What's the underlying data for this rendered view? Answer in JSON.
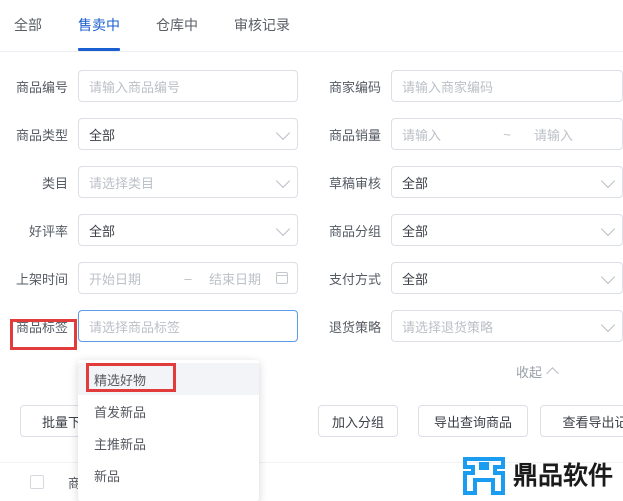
{
  "tabs": [
    {
      "label": "全部",
      "active": false
    },
    {
      "label": "售卖中",
      "active": true
    },
    {
      "label": "仓库中",
      "active": false
    },
    {
      "label": "审核记录",
      "active": false
    }
  ],
  "filters": {
    "rows": [
      {
        "left": {
          "label": "商品编号",
          "type": "input",
          "placeholder": "请输入商品编号",
          "value": ""
        },
        "right": {
          "label": "商家编码",
          "type": "input",
          "placeholder": "请输入商家编码",
          "value": ""
        }
      },
      {
        "left": {
          "label": "商品类型",
          "type": "select",
          "placeholder": "",
          "value": "全部"
        },
        "right": {
          "label": "商品销量",
          "type": "range",
          "placeholder_min": "请输入",
          "separator": "~",
          "placeholder_max": "请输入"
        }
      },
      {
        "left": {
          "label": "类目",
          "type": "select",
          "placeholder": "请选择类目",
          "value": ""
        },
        "right": {
          "label": "草稿审核",
          "type": "select",
          "placeholder": "",
          "value": "全部"
        }
      },
      {
        "left": {
          "label": "好评率",
          "type": "select",
          "placeholder": "",
          "value": "全部"
        },
        "right": {
          "label": "商品分组",
          "type": "select",
          "placeholder": "",
          "value": "全部"
        }
      },
      {
        "left": {
          "label": "上架时间",
          "type": "daterange",
          "placeholder_start": "开始日期",
          "separator": "–",
          "placeholder_end": "结束日期"
        },
        "right": {
          "label": "支付方式",
          "type": "select",
          "placeholder": "",
          "value": "全部"
        }
      },
      {
        "left": {
          "label": "商品标签",
          "type": "select",
          "placeholder": "请选择商品标签",
          "value": "",
          "focused": true
        },
        "right": {
          "label": "退货策略",
          "type": "select",
          "placeholder": "请选择退货策略",
          "value": ""
        }
      }
    ],
    "collapse_label": "收起"
  },
  "dropdown": {
    "items": [
      {
        "label": "精选好物",
        "hovered": true
      },
      {
        "label": "首发新品",
        "hovered": false
      },
      {
        "label": "主推新品",
        "hovered": false
      },
      {
        "label": "新品",
        "hovered": false
      }
    ]
  },
  "actions": {
    "batch_offshelf": "批量下架",
    "add_group": "加入分组",
    "export_query": "导出查询商品",
    "view_export_records": "查看导出记"
  },
  "table": {
    "header": {
      "product_column": "商品"
    }
  },
  "annotations": {
    "label_box_color": "#e23b3b",
    "item_box_color": "#e23b3b"
  },
  "watermark": {
    "text": "鼎品软件",
    "mark_color": "#1a9cf0"
  },
  "colors": {
    "active_tab": "#1a5fd0",
    "focus_border": "#5b9bea",
    "annotation_red": "#e23b3b",
    "border": "#dcdfe6",
    "placeholder": "#bcc0c7"
  }
}
